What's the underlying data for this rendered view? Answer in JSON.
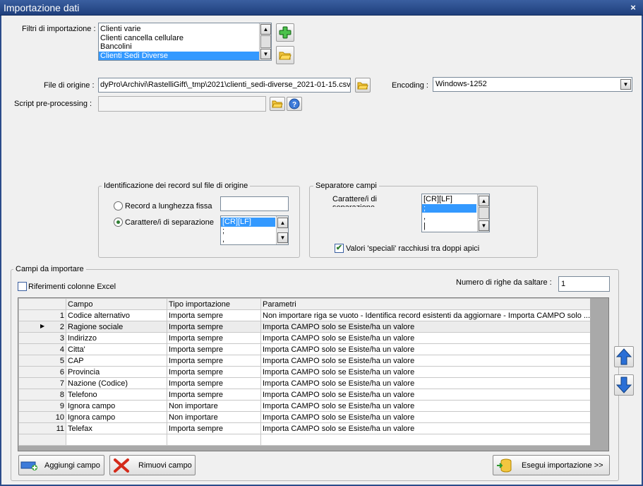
{
  "window": {
    "title": "Importazione dati",
    "close": "×"
  },
  "filters": {
    "label": "Filtri di importazione :",
    "items": [
      "Clienti varie",
      "Clienti cancella cellulare",
      "Bancolini",
      "Clienti Sedi Diverse"
    ],
    "selected": 3
  },
  "source": {
    "label": "File di origine :",
    "value": "dyPro\\Archivi\\RastelliGift\\_tmp\\2021\\clienti_sedi-diverse_2021-01-15.csv"
  },
  "encoding": {
    "label": "Encoding :",
    "value": "Windows-1252"
  },
  "script": {
    "label": "Script pre-processing :",
    "value": ""
  },
  "record_id": {
    "title": "Identificazione dei record sul file di origine",
    "fixed_label": "Record a lunghezza fissa",
    "fixed_value": "",
    "sep_label": "Carattere/i di separazione",
    "sep_items": [
      "[CR][LF]",
      ";",
      ","
    ],
    "sep_selected": 0
  },
  "field_sep": {
    "title": "Separatore campi",
    "chars_label": "Carattere/i di separazione",
    "items": [
      "[CR][LF]",
      ";",
      ",",
      "|"
    ],
    "selected": 1,
    "quotes_label": "Valori 'speciali' racchiusi tra doppi apici",
    "quotes_checked": true
  },
  "fields": {
    "title": "Campi da importare",
    "excel_label": "Riferimenti colonne Excel",
    "skip_label": "Numero di righe da saltare :",
    "skip_value": "1",
    "columns": [
      "Campo",
      "Tipo importazione",
      "Parametri"
    ],
    "rows": [
      {
        "n": "1",
        "campo": "Codice alternativo",
        "tipo": "Importa sempre",
        "param": "Non importare riga se vuoto - Identifica record esistenti da aggiornare - Importa CAMPO solo ..."
      },
      {
        "n": "2",
        "campo": "Ragione sociale",
        "tipo": "Importa sempre",
        "param": "Importa CAMPO solo se Esiste/ha un valore"
      },
      {
        "n": "3",
        "campo": "Indirizzo",
        "tipo": "Importa sempre",
        "param": "Importa CAMPO solo se Esiste/ha un valore"
      },
      {
        "n": "4",
        "campo": "Citta'",
        "tipo": "Importa sempre",
        "param": "Importa CAMPO solo se Esiste/ha un valore"
      },
      {
        "n": "5",
        "campo": "CAP",
        "tipo": "Importa sempre",
        "param": "Importa CAMPO solo se Esiste/ha un valore"
      },
      {
        "n": "6",
        "campo": "Provincia",
        "tipo": "Importa sempre",
        "param": "Importa CAMPO solo se Esiste/ha un valore"
      },
      {
        "n": "7",
        "campo": "Nazione (Codice)",
        "tipo": "Importa sempre",
        "param": "Importa CAMPO solo se Esiste/ha un valore"
      },
      {
        "n": "8",
        "campo": "Telefono",
        "tipo": "Importa sempre",
        "param": "Importa CAMPO solo se Esiste/ha un valore"
      },
      {
        "n": "9",
        "campo": "Ignora campo",
        "tipo": "Non importare",
        "param": "Importa CAMPO solo se Esiste/ha un valore"
      },
      {
        "n": "10",
        "campo": "Ignora campo",
        "tipo": "Non importare",
        "param": "Importa CAMPO solo se Esiste/ha un valore"
      },
      {
        "n": "11",
        "campo": "Telefax",
        "tipo": "Importa sempre",
        "param": "Importa CAMPO solo se Esiste/ha un valore"
      }
    ],
    "current_row": 1
  },
  "buttons": {
    "add": "Aggiungi campo",
    "remove": "Rimuovi campo",
    "run": "Esegui importazione >>"
  }
}
